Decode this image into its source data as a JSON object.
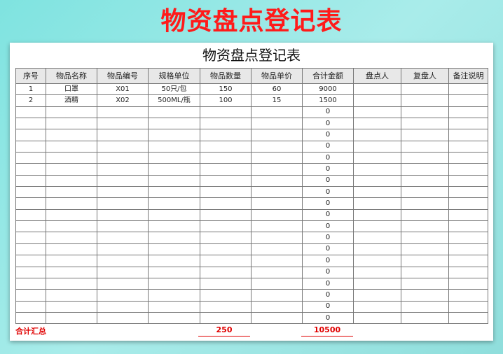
{
  "banner": {
    "title": "物资盘点登记表"
  },
  "sheet": {
    "title": "物资盘点登记表",
    "columns": [
      "序号",
      "物品名称",
      "物品编号",
      "规格单位",
      "物品数量",
      "物品单价",
      "合计金额",
      "盘点人",
      "复盘人",
      "备注说明"
    ],
    "rows": [
      [
        "1",
        "口罩",
        "X01",
        "50只/包",
        "150",
        "60",
        "9000",
        "",
        "",
        ""
      ],
      [
        "2",
        "酒精",
        "X02",
        "500ML/瓶",
        "100",
        "15",
        "1500",
        "",
        "",
        ""
      ],
      [
        "",
        "",
        "",
        "",
        "",
        "",
        "0",
        "",
        "",
        ""
      ],
      [
        "",
        "",
        "",
        "",
        "",
        "",
        "0",
        "",
        "",
        ""
      ],
      [
        "",
        "",
        "",
        "",
        "",
        "",
        "0",
        "",
        "",
        ""
      ],
      [
        "",
        "",
        "",
        "",
        "",
        "",
        "0",
        "",
        "",
        ""
      ],
      [
        "",
        "",
        "",
        "",
        "",
        "",
        "0",
        "",
        "",
        ""
      ],
      [
        "",
        "",
        "",
        "",
        "",
        "",
        "0",
        "",
        "",
        ""
      ],
      [
        "",
        "",
        "",
        "",
        "",
        "",
        "0",
        "",
        "",
        ""
      ],
      [
        "",
        "",
        "",
        "",
        "",
        "",
        "0",
        "",
        "",
        ""
      ],
      [
        "",
        "",
        "",
        "",
        "",
        "",
        "0",
        "",
        "",
        ""
      ],
      [
        "",
        "",
        "",
        "",
        "",
        "",
        "0",
        "",
        "",
        ""
      ],
      [
        "",
        "",
        "",
        "",
        "",
        "",
        "0",
        "",
        "",
        ""
      ],
      [
        "",
        "",
        "",
        "",
        "",
        "",
        "0",
        "",
        "",
        ""
      ],
      [
        "",
        "",
        "",
        "",
        "",
        "",
        "0",
        "",
        "",
        ""
      ],
      [
        "",
        "",
        "",
        "",
        "",
        "",
        "0",
        "",
        "",
        ""
      ],
      [
        "",
        "",
        "",
        "",
        "",
        "",
        "0",
        "",
        "",
        ""
      ],
      [
        "",
        "",
        "",
        "",
        "",
        "",
        "0",
        "",
        "",
        ""
      ],
      [
        "",
        "",
        "",
        "",
        "",
        "",
        "0",
        "",
        "",
        ""
      ],
      [
        "",
        "",
        "",
        "",
        "",
        "",
        "0",
        "",
        "",
        ""
      ],
      [
        "",
        "",
        "",
        "",
        "",
        "",
        "0",
        "",
        "",
        ""
      ]
    ]
  },
  "totals": {
    "label": "合计汇总",
    "quantity": "250",
    "amount": "10500"
  },
  "colors": {
    "banner_title": "#ff1a1a",
    "totals": "#e00000",
    "header_bg": "#e8e8e8"
  }
}
